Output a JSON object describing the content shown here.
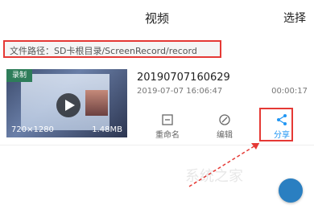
{
  "header": {
    "title": "视频",
    "select_label": "选择"
  },
  "path_bar": {
    "text": "文件路径：SD卡根目录/ScreenRecord/record"
  },
  "video": {
    "badge": "录制",
    "resolution": "720×1280",
    "size": "1.48MB",
    "name": "20190707160629",
    "date": "2019-07-07 16:06:47",
    "duration": "00:00:17"
  },
  "actions": {
    "rename": "重命名",
    "edit": "编辑",
    "share": "分享"
  },
  "watermark": "系统之家",
  "colors": {
    "highlight": "#e53935",
    "accent": "#2196f3"
  }
}
